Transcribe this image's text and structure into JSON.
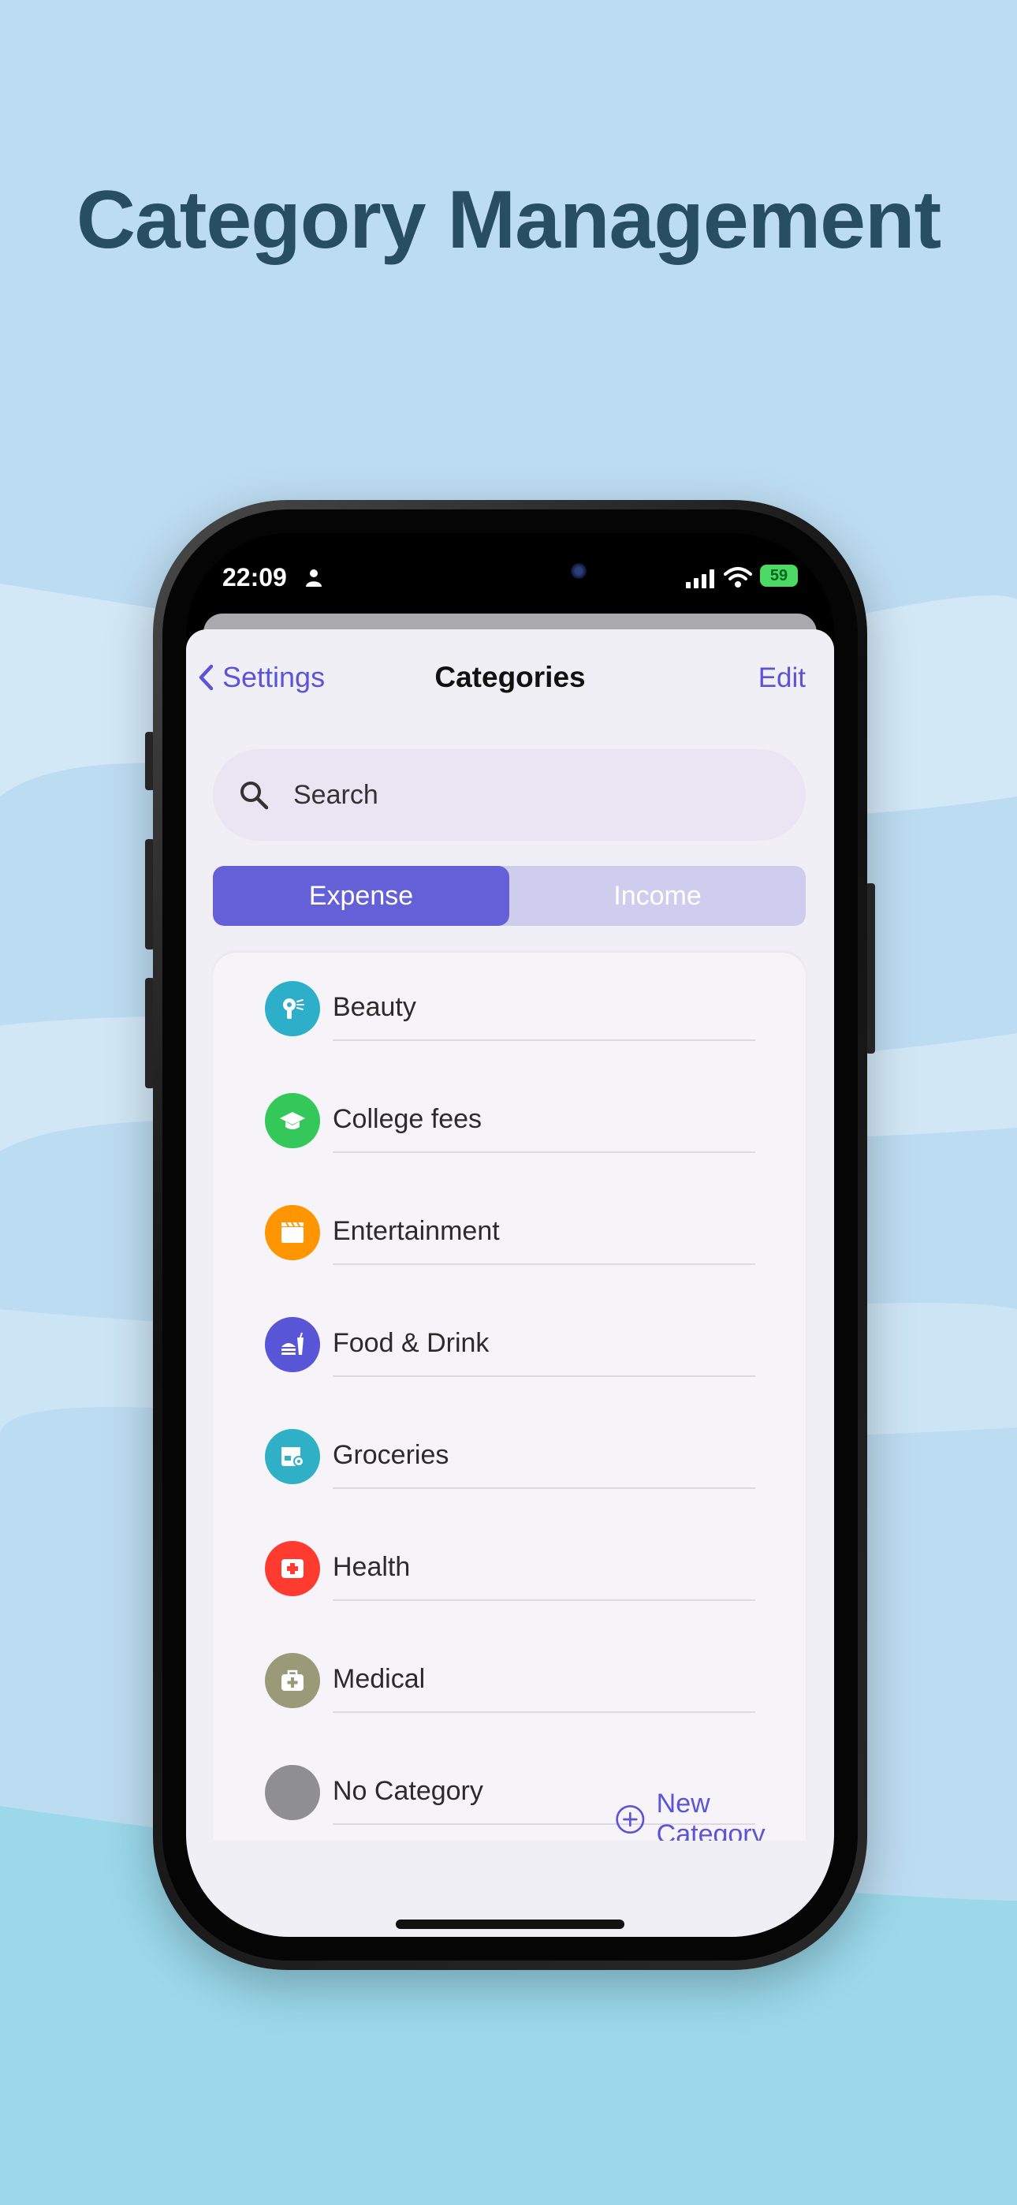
{
  "headline": "Category Management",
  "status_bar": {
    "time": "22:09",
    "battery": "59"
  },
  "nav": {
    "back_label": "Settings",
    "title": "Categories",
    "edit_label": "Edit"
  },
  "search": {
    "placeholder": "Search"
  },
  "segments": {
    "expense": "Expense",
    "income": "Income",
    "selected": "Expense"
  },
  "categories": [
    {
      "name": "Beauty",
      "icon": "hair-dryer-icon",
      "color": "#2eafc9"
    },
    {
      "name": "College fees",
      "icon": "graduation-cap-icon",
      "color": "#34c759"
    },
    {
      "name": "Entertainment",
      "icon": "clapperboard-icon",
      "color": "#ff9500"
    },
    {
      "name": "Food & Drink",
      "icon": "food-drink-icon",
      "color": "#5856d6"
    },
    {
      "name": "Groceries",
      "icon": "store-icon",
      "color": "#30b0c7"
    },
    {
      "name": "Health",
      "icon": "first-aid-icon",
      "color": "#ff3b30"
    },
    {
      "name": "Medical",
      "icon": "medical-bag-icon",
      "color": "#9a9a79"
    },
    {
      "name": "No Category",
      "icon": "",
      "color": "#8e8e93"
    }
  ],
  "actions": {
    "new_category": "New Category"
  },
  "colors": {
    "accent": "#5b54d6",
    "segment_active": "#6460d8",
    "headline": "#284e62"
  }
}
